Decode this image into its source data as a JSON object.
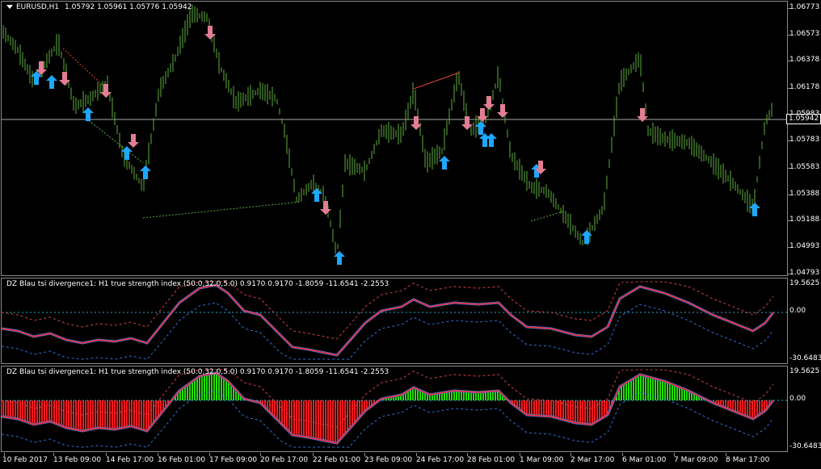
{
  "main": {
    "symbol": "EURUSD,H1",
    "ohlc": "1.05792 1.05961 1.05776 1.05942",
    "price_scale": [
      "1.06773",
      "1.06573",
      "1.06378",
      "1.06178",
      "1.05983",
      "1.05783",
      "1.05583",
      "1.05388",
      "1.05188",
      "1.04993",
      "1.04793"
    ],
    "current_price": "1.05942",
    "colors": {
      "candle": "#5fae3c",
      "buy_arrow": "#1ea7ff",
      "sell_arrow": "#e27d93",
      "grid": "#8c8c8c",
      "price_line": "#a8a8a8"
    },
    "buy_arrows": 14,
    "sell_arrows": 13
  },
  "indicator1": {
    "title": "DZ Blau tsi divergence1: H1 true strength index (50.0,32,0,5.0) 0.9170 0.9170 -1.8059 -11.6541 -2.2553",
    "scale": [
      "19.5625",
      "0.00",
      "-30.6483"
    ]
  },
  "indicator2": {
    "title": "DZ Blau tsi divergence1: H1 true strength index (50.0,32,0,5.0) 0.9170 0.9170 -1.8059 -11.6541 -2.2553",
    "scale": [
      "19.5625",
      "0.00",
      "-30.6483"
    ]
  },
  "time_axis": [
    "10 Feb 2017",
    "13 Feb 09:00",
    "14 Feb 17:00",
    "16 Feb 01:00",
    "17 Feb 09:00",
    "20 Feb 17:00",
    "22 Feb 01:00",
    "23 Feb 09:00",
    "24 Feb 17:00",
    "28 Feb 01:00",
    "1 Mar 09:00",
    "2 Mar 17:00",
    "6 Mar 01:00",
    "7 Mar 09:00",
    "8 Mar 17:00"
  ]
}
